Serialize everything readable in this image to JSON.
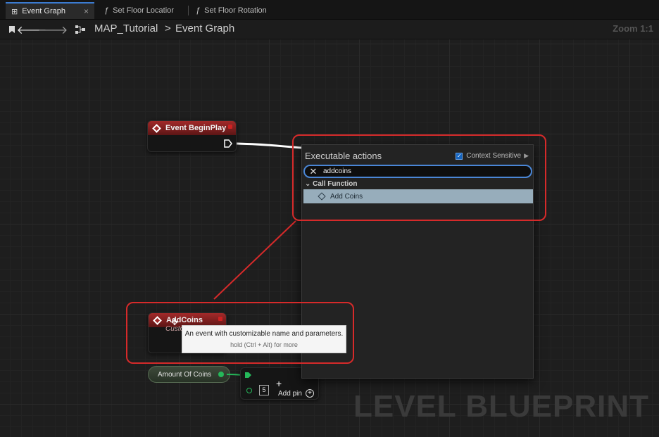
{
  "tabs": [
    {
      "label": "Event Graph",
      "active": true,
      "closable": true,
      "icon": "graph-icon"
    },
    {
      "label": "Set Floor Locatior",
      "active": false,
      "icon": "function-icon"
    },
    {
      "label": "Set Floor Rotation",
      "active": false,
      "icon": "function-icon"
    }
  ],
  "nav": {
    "breadcrumb_root": "MAP_Tutorial",
    "breadcrumb_sep": ">",
    "breadcrumb_current": "Event Graph",
    "zoom": "Zoom 1:1"
  },
  "graph": {
    "watermark": "LEVEL BLUEPRINT",
    "nodes": {
      "begin_play": {
        "title": "Event BeginPlay"
      },
      "add_coins": {
        "title": "AddCoins",
        "subtitle": "Custo"
      },
      "amount": {
        "label": "Amount Of Coins"
      },
      "make_array": {
        "value": "5",
        "add_pin_label": "Add pin"
      }
    }
  },
  "action_menu": {
    "title": "Executable actions",
    "context_sensitive_label": "Context Sensitive",
    "context_sensitive_checked": true,
    "search_value": "addcoins",
    "category": "Call Function",
    "results": [
      {
        "label": "Add Coins",
        "selected": true
      }
    ]
  },
  "tooltip": {
    "text": "An event with customizable name and parameters.",
    "hint": "hold (Ctrl + Alt) for more"
  },
  "colors": {
    "event_header": "#a22a2a",
    "selection": "#97adbb",
    "search_border": "#4a86d6",
    "highlight": "#d62a2a",
    "int_pin": "#25b85a"
  }
}
